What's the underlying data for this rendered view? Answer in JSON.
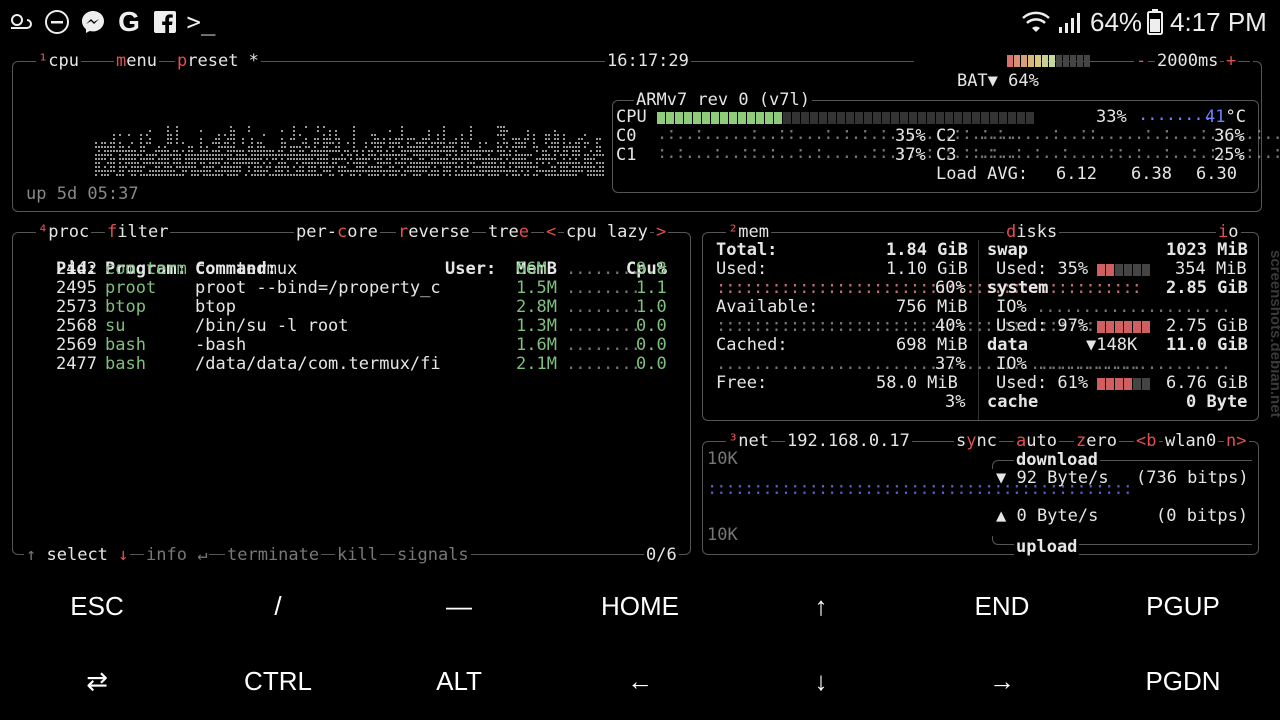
{
  "statusbar": {
    "left_icons": [
      "weather-icon",
      "do-not-disturb-icon",
      "messenger-icon",
      "google-icon",
      "facebook-icon",
      "terminal-icon"
    ],
    "battery_pct": "64%",
    "time": "4:17 PM"
  },
  "cpu_box": {
    "tab_num": "¹",
    "tab": "cpu",
    "menu": "menu",
    "preset": "preset *",
    "clock": "16:17:29",
    "bat_label": "BAT▼ 64%",
    "bat_fill": 0.64,
    "interval_minus": "-",
    "interval": "2000ms",
    "interval_plus": "+",
    "uptime": "up 5d 05:37",
    "model": "ARMv7 rev 0 (v7l)",
    "cpu_label": "CPU",
    "cpu_pct": "33%",
    "cpu_fill": 0.33,
    "temp": "41",
    "temp_unit": "°C",
    "cores": [
      {
        "name": "C0",
        "pct": "35%"
      },
      {
        "name": "C1",
        "pct": "37%"
      },
      {
        "name": "C2",
        "pct": "36%"
      },
      {
        "name": "C3",
        "pct": "25%"
      }
    ],
    "load_label": "Load AVG:",
    "load": [
      "6.12",
      "6.38",
      "6.30"
    ]
  },
  "proc_box": {
    "tab_num": "⁴",
    "tab": "proc",
    "filter": "filter",
    "per_core": "per-core",
    "reverse": "reverse",
    "tree": "tree",
    "sort_left": "<",
    "sort": "cpu lazy",
    "sort_right": ">",
    "headers": {
      "pid": "Pid:",
      "program": "Program:",
      "command": "Command:",
      "user": "User:",
      "mem": "MemB",
      "cpu": "Cpu%"
    },
    "rows": [
      {
        "pid": "2442",
        "program": "com.term",
        "command": "com.termux",
        "mem": "66M",
        "cpu": "9.8"
      },
      {
        "pid": "2495",
        "program": "proot",
        "command": "proot --bind=/property_c",
        "mem": "1.5M",
        "cpu": "1.1"
      },
      {
        "pid": "2573",
        "program": "btop",
        "command": "btop",
        "mem": "2.8M",
        "cpu": "1.0"
      },
      {
        "pid": "2568",
        "program": "su",
        "command": "/bin/su -l root",
        "mem": "1.3M",
        "cpu": "0.0"
      },
      {
        "pid": "2569",
        "program": "bash",
        "command": "-bash",
        "mem": "1.6M",
        "cpu": "0.0"
      },
      {
        "pid": "2477",
        "program": "bash",
        "command": "/data/data/com.termux/fi",
        "mem": "2.1M",
        "cpu": "0.0"
      }
    ],
    "footer": {
      "select": "select",
      "info": "info",
      "terminate": "terminate",
      "kill": "kill",
      "signals": "signals",
      "count": "0/6"
    }
  },
  "mem_box": {
    "tab_num": "²",
    "tab": "mem",
    "disks_tab": "disks",
    "io_tab": "io",
    "total_label": "Total:",
    "total": "1.84 GiB",
    "used_label": "Used:",
    "used": "1.10 GiB",
    "used_pct": "60%",
    "avail_label": "Available:",
    "avail": "756 MiB",
    "avail_pct": "40%",
    "cached_label": "Cached:",
    "cached": "698 MiB",
    "cached_pct": "37%",
    "free_label": "Free:",
    "free": "58.0 MiB",
    "free_pct": "3%",
    "disks": {
      "swap_label": "swap",
      "swap_size": "1023 MiB",
      "swap_used_label": "Used: 35%",
      "swap_used_fill": 0.35,
      "swap_used": "354 MiB",
      "system_label": "system",
      "system_size": "2.85 GiB",
      "io1": "IO%",
      "system_used_label": "Used: 97%",
      "system_used_fill": 0.97,
      "system_used": "2.75 GiB",
      "data_label": "data",
      "data_io": "▼148K",
      "data_size": "11.0 GiB",
      "io2": "IO%",
      "data_used_label": "Used: 61%",
      "data_used_fill": 0.61,
      "data_used": "6.76 GiB",
      "cache_label": "cache",
      "cache_size": "0 Byte"
    }
  },
  "net_box": {
    "tab_num": "³",
    "tab": "net",
    "ip": "192.168.0.17",
    "sync": "sync",
    "auto": "auto",
    "zero": "zero",
    "prev": "<b",
    "iface": "wlan0",
    "next": "n>",
    "scale_top": "10K",
    "scale_bottom": "10K",
    "download": "download",
    "down_rate": "▼ 92 Byte/s",
    "down_bits": "(736 bitps)",
    "up_rate": "▲ 0 Byte/s",
    "up_bits": "(0 bitps)",
    "upload": "upload"
  },
  "watermark": "screenshots.debian.net",
  "extra_keys": {
    "row1": [
      "ESC",
      "/",
      "—",
      "HOME",
      "↑",
      "END",
      "PGUP"
    ],
    "row2": [
      "⇄",
      "CTRL",
      "ALT",
      "←",
      "↓",
      "→",
      "PGDN"
    ]
  },
  "colors": {
    "accent_red": "#e05050",
    "proc_green": "#8fcc7a",
    "cpu_bar_green": "#8fcc7a",
    "net_blue": "#6f7fff"
  }
}
